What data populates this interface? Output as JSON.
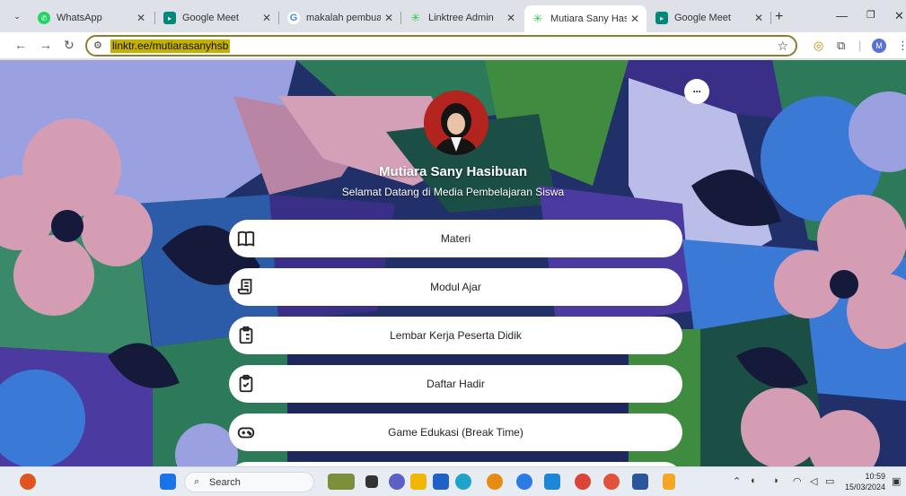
{
  "browser": {
    "tabs": [
      {
        "title": "WhatsApp",
        "favicon": "whatsapp-icon",
        "color": "#25d366"
      },
      {
        "title": "Google Meet",
        "favicon": "google-meet-icon",
        "color": "#00897b"
      },
      {
        "title": "makalah pembuatan",
        "favicon": "google-icon",
        "color": "#4285f4"
      },
      {
        "title": "Linktree Admin",
        "favicon": "linktree-icon",
        "color": "#43e660"
      },
      {
        "title": "Mutiara Sany Hasibu",
        "favicon": "linktree-icon",
        "color": "#43e660"
      },
      {
        "title": "Google Meet",
        "favicon": "google-meet-icon",
        "color": "#00897b"
      }
    ],
    "url": "linktr.ee/mutiarasanyhsb",
    "profile_initial": "M"
  },
  "profile": {
    "name": "Mutiara Sany Hasibuan",
    "bio": "Selamat Datang di Media Pembelajaran Siswa",
    "more_label": "···"
  },
  "links": [
    {
      "label": "Materi",
      "icon": "book-icon"
    },
    {
      "label": "Modul Ajar",
      "icon": "scroll-icon"
    },
    {
      "label": "Lembar Kerja Peserta Didik",
      "icon": "clipboard-list-icon"
    },
    {
      "label": "Daftar Hadir",
      "icon": "clipboard-check-icon"
    },
    {
      "label": "Game Edukasi (Break Time)",
      "icon": "gamepad-icon"
    }
  ],
  "taskbar": {
    "search_label": "Search",
    "time": "10:59",
    "date": "15/03/2024"
  },
  "colors": {
    "accent_highlight": "#c6b000",
    "page_bg": "#1f2d5c"
  }
}
